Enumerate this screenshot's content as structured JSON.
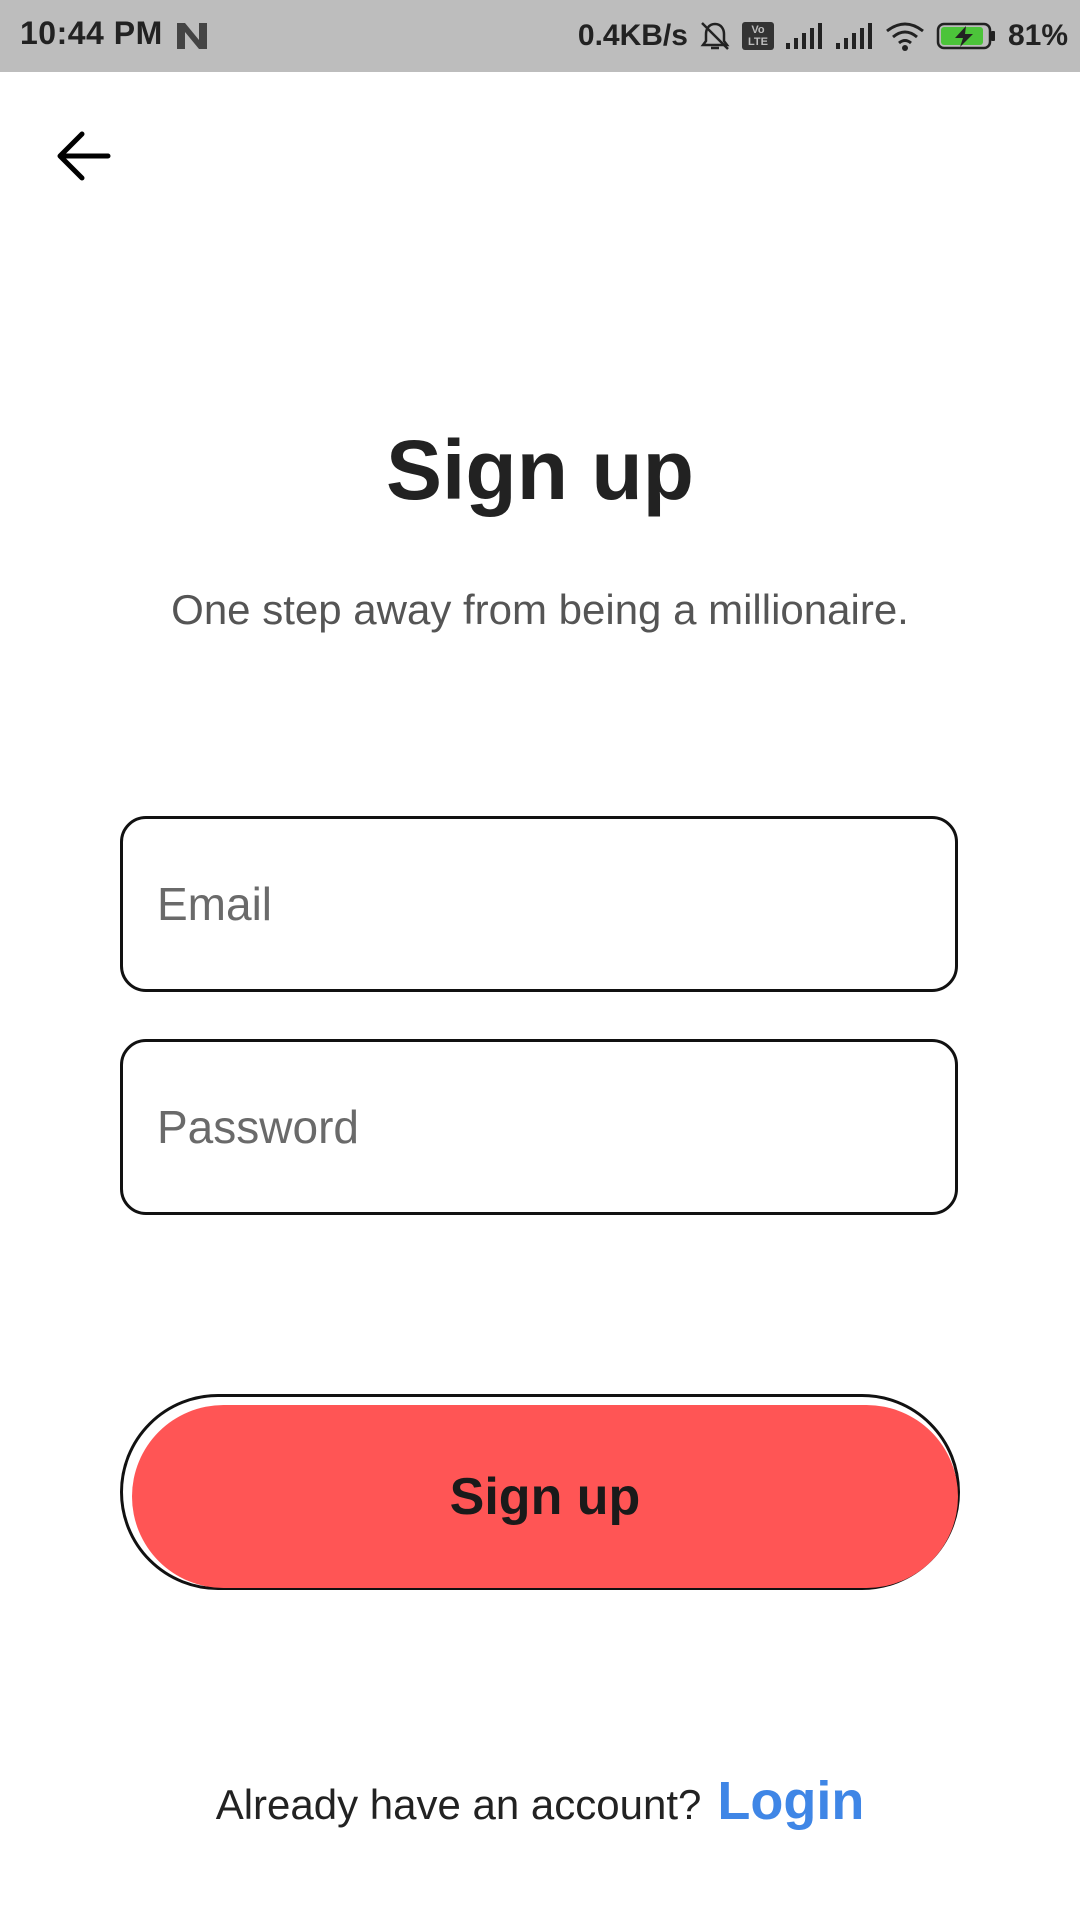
{
  "status_bar": {
    "time": "10:44 PM",
    "network_speed": "0.4KB/s",
    "volte_label": "Vo LTE",
    "battery_percent": "81%",
    "background_color": "#bdbdbd",
    "icons": [
      "n-icon",
      "mute-icon",
      "volte-icon",
      "signal-icon",
      "signal-icon",
      "wifi-icon",
      "battery-charging-icon"
    ]
  },
  "header": {
    "back_icon": "arrow-left-icon"
  },
  "main": {
    "title": "Sign up",
    "subtitle": "One step away from being a millionaire."
  },
  "form": {
    "email_placeholder": "Email",
    "email_value": "",
    "password_placeholder": "Password",
    "password_value": "",
    "submit_label": "Sign up"
  },
  "footer": {
    "prompt": "Already have an account?",
    "login_label": "Login"
  },
  "colors": {
    "accent": "#ff5555",
    "link": "#3f86e6",
    "text": "#222222"
  }
}
